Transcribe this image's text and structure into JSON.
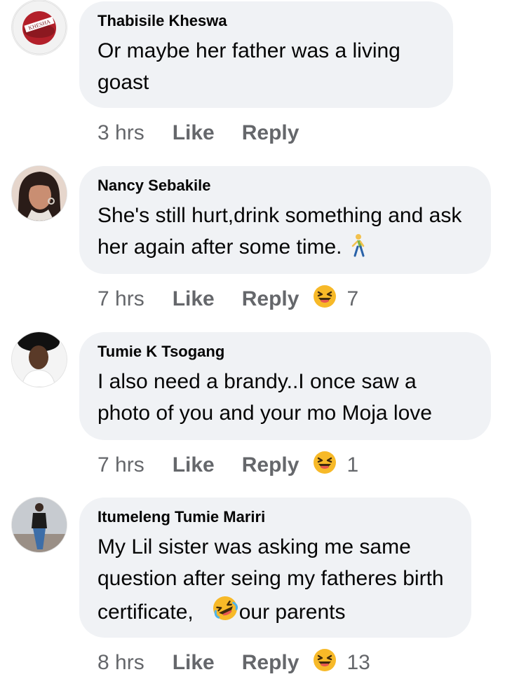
{
  "comments": [
    {
      "author": "Thabisile Kheswa",
      "avatar_badge_text": "KHESHA",
      "text": "Or maybe her father was a living goast",
      "time": "3 hrs",
      "like_label": "Like",
      "reply_label": "Reply",
      "reaction_count": ""
    },
    {
      "author": "Nancy Sebakile",
      "text": "She's  still hurt,drink something and ask her again after some time.",
      "time": "7 hrs",
      "like_label": "Like",
      "reply_label": "Reply",
      "reaction_icon": "laughing-emoji",
      "reaction_count": "7"
    },
    {
      "author": "Tumie K Tsogang",
      "text": "I also need a brandy..I once saw a photo of you and your mo Moja love",
      "time": "7 hrs",
      "like_label": "Like",
      "reply_label": "Reply",
      "reaction_icon": "laughing-emoji",
      "reaction_count": "1"
    },
    {
      "author": "Itumeleng Tumie Mariri",
      "text_part1": "My Lil sister was asking me same question after seing my fatheres birth certificate,",
      "text_part2": "our parents",
      "time": "8 hrs",
      "like_label": "Like",
      "reply_label": "Reply",
      "reaction_icon": "laughing-emoji",
      "reaction_count": "13"
    }
  ],
  "colors": {
    "bubble": "#f0f2f5",
    "meta_text": "#65676b",
    "author_text": "#050505"
  }
}
